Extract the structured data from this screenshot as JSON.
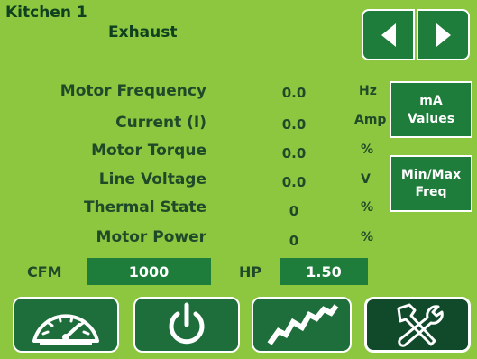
{
  "header": {
    "title_line1": "Kitchen 1",
    "title_line2": "Exhaust"
  },
  "arrows": {
    "prev_icon": "triangle-left-icon",
    "next_icon": "triangle-right-icon"
  },
  "readings": [
    {
      "label": "Motor Frequency",
      "value": "0.0",
      "unit": "Hz"
    },
    {
      "label": "Current (I)",
      "value": "0.0",
      "unit": "Amp"
    },
    {
      "label": "Motor Torque",
      "value": "0.0",
      "unit": "%"
    },
    {
      "label": "Line Voltage",
      "value": "0.0",
      "unit": "V"
    },
    {
      "label": "Thermal State",
      "value": "0",
      "unit": "%"
    },
    {
      "label": "Motor Power",
      "value": "0",
      "unit": "%"
    }
  ],
  "buttons": {
    "ma_line1": "mA",
    "ma_line2": "Values",
    "minmax_line1": "Min/Max",
    "minmax_line2": "Freq"
  },
  "fields": {
    "cfm_label": "CFM",
    "cfm_value": "1000",
    "hp_label": "HP",
    "hp_value": "1.50"
  },
  "bottom_nav": [
    {
      "icon": "gauge-icon"
    },
    {
      "icon": "power-icon"
    },
    {
      "icon": "trend-icon"
    },
    {
      "icon": "tools-icon",
      "active": true
    }
  ],
  "colors": {
    "background": "#8dc63f",
    "button": "#1e7d3a",
    "text": "#1f4a2a"
  }
}
